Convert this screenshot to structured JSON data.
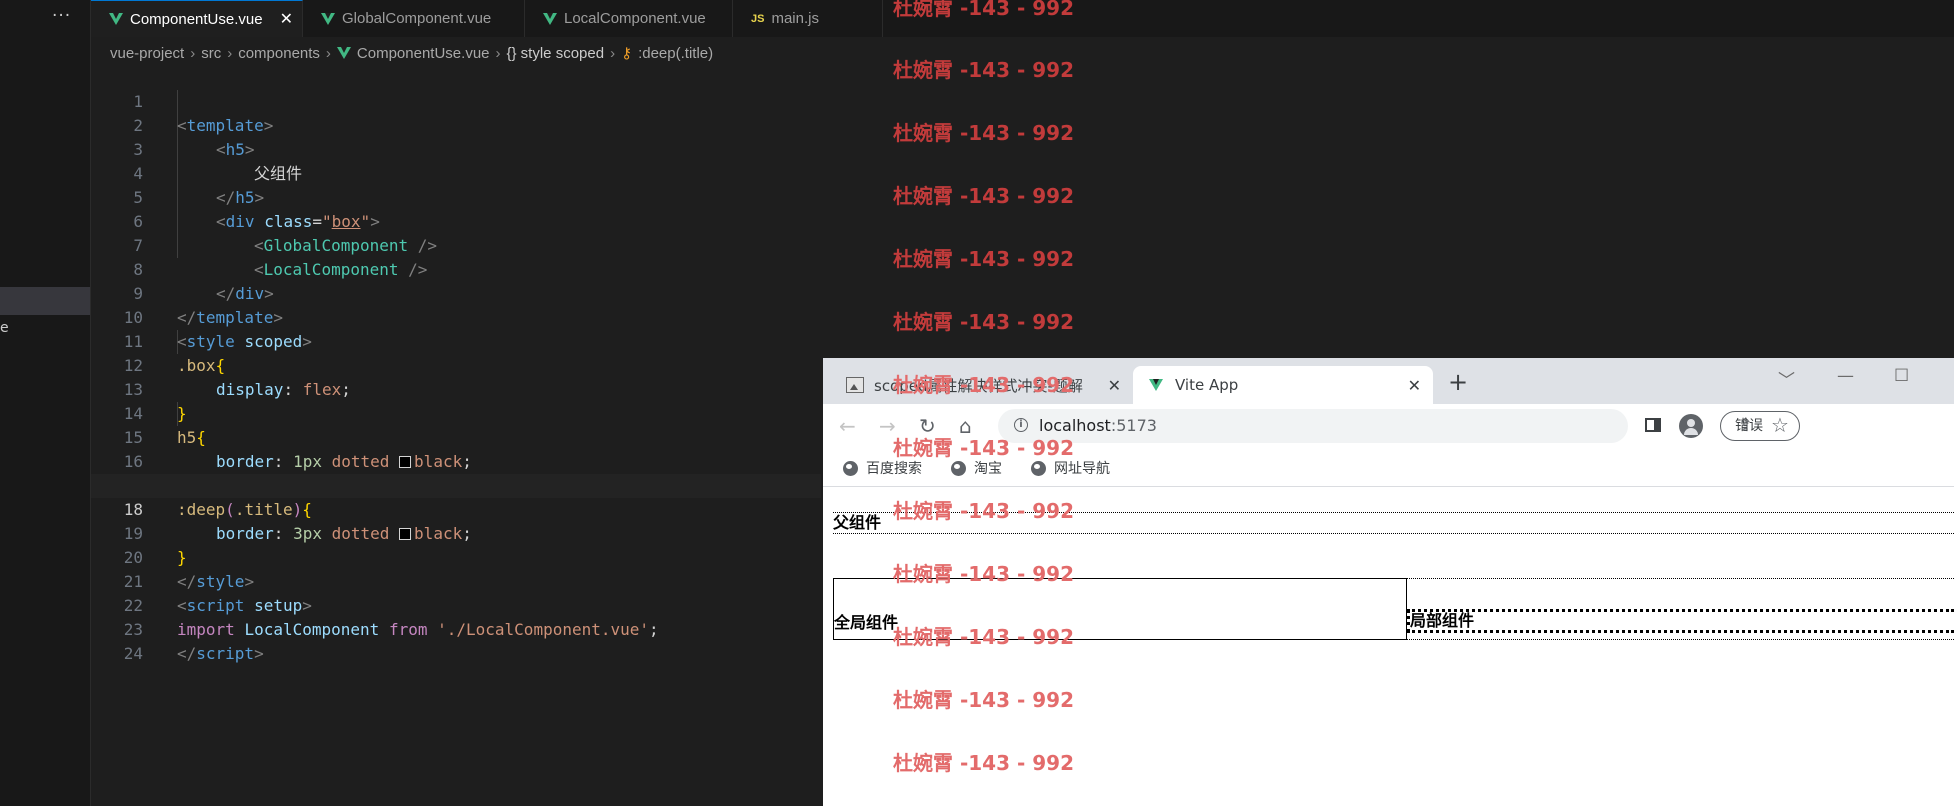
{
  "vscode": {
    "sidebar_partial_text": "e",
    "tabs": [
      {
        "label": "ComponentUse.vue",
        "icon": "vue-icon",
        "active": true
      },
      {
        "label": "GlobalComponent.vue",
        "icon": "vue-icon",
        "active": false
      },
      {
        "label": "LocalComponent.vue",
        "icon": "vue-icon",
        "active": false
      },
      {
        "label": "main.js",
        "icon": "js-icon",
        "active": false
      }
    ],
    "js_icon_text": "JS",
    "more_actions": "···",
    "breadcrumb": [
      "vue-project",
      "src",
      "components",
      "ComponentUse.vue",
      "{} style scoped",
      ":deep(.title)"
    ],
    "current_line": 18,
    "code": {
      "l1_open": "<",
      "l1_tag": "template",
      "l1_close": ">",
      "l2_open": "<",
      "l2_tag": "h5",
      "l2_close": ">",
      "l3_text": "父组件",
      "l4_open": "</",
      "l4_tag": "h5",
      "l4_close": ">",
      "l5_open": "<",
      "l5_tag": "div",
      "l5_attr": "class",
      "l5_eq": "=",
      "l5_q1": "\"",
      "l5_val": "box",
      "l5_q2": "\"",
      "l5_close": ">",
      "l6_open": "<",
      "l6_comp": "GlobalComponent",
      "l6_close": " />",
      "l7_open": "<",
      "l7_comp": "LocalComponent",
      "l7_close": " />",
      "l8_open": "</",
      "l8_tag": "div",
      "l8_close": ">",
      "l9_open": "</",
      "l9_tag": "template",
      "l9_close": ">",
      "l10_open": "<",
      "l10_tag": "style",
      "l10_attr": "scoped",
      "l10_close": ">",
      "l11_sel": ".box",
      "l11_brace": "{",
      "l12_prop": "display",
      "l12_colon": ": ",
      "l12_val": "flex",
      "l12_semi": ";",
      "l13_brace": "}",
      "l14_sel": "h5",
      "l14_brace": "{",
      "l15_prop": "border",
      "l15_colon": ": ",
      "l15_num": "1px",
      "l15_style": "dotted",
      "l15_color": "black",
      "l15_semi": ";",
      "l16_brace": "}",
      "l17_sel": ":deep",
      "l17_paren": "(",
      "l17_arg": ".title",
      "l17_paren2": ")",
      "l17_brace": "{",
      "l18_prop": "border",
      "l18_colon": ": ",
      "l18_num": "3px",
      "l18_style": "dotted",
      "l18_color": "black",
      "l18_semi": ";",
      "l19_brace": "}",
      "l20_open": "</",
      "l20_tag": "style",
      "l20_close": ">",
      "l21_open": "<",
      "l21_tag": "script",
      "l21_attr": "setup",
      "l21_close": ">",
      "l22_kw": "import",
      "l22_id": "LocalComponent",
      "l22_from": "from",
      "l22_str": "'./LocalComponent.vue'",
      "l22_semi": ";",
      "l23_open": "</",
      "l23_tag": "script",
      "l23_close": ">"
    },
    "line_numbers": [
      "1",
      "2",
      "3",
      "4",
      "5",
      "6",
      "7",
      "8",
      "9",
      "10",
      "11",
      "12",
      "13",
      "14",
      "15",
      "16",
      "17",
      "18",
      "19",
      "20",
      "21",
      "22",
      "23",
      "24"
    ]
  },
  "watermark_text": "杜婉霄 -143 - 992",
  "browser": {
    "tabs": [
      {
        "label": "scoped属性解决样式冲突-题解",
        "icon": "image-icon",
        "active": false
      },
      {
        "label": "Vite App",
        "icon": "vue-icon",
        "active": true
      }
    ],
    "tab_close": "✕",
    "new_tab": "+",
    "url_host": "localhost",
    "url_port": ":5173",
    "error_button": "错误",
    "bookmarks": [
      "百度搜索",
      "淘宝",
      "网址导航"
    ],
    "page": {
      "h5_text": "父组件",
      "global_component": "全局组件",
      "local_component": "局部组件"
    }
  },
  "colors": {
    "editor_bg": "#1e1e1e",
    "watermark": "#c23b3b",
    "vue_green": "#41b883"
  }
}
